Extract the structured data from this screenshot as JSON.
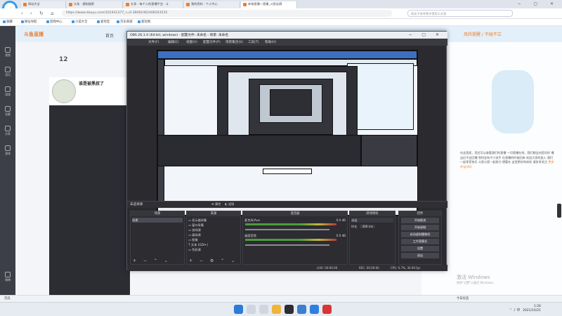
{
  "browser": {
    "tabs": [
      "网站大全",
      "头条 · 搜狗搜索",
      "头条 - 每个人的直播平台 · 斗",
      "我的资料 - 个人中心",
      "体育直播一直播_斗鱼无碍"
    ],
    "url": "https://www.douyu.com/101441377_r=0.36092462408203535",
    "search_placeholder": "周女子高考数学惯用公式表",
    "bookmarks": [
      "收藏",
      "网址导航",
      "游戏中心",
      "小说大全",
      "爱淘宝",
      "京东商城",
      "爱玩网"
    ]
  },
  "sidebar": {
    "items": [
      "视频",
      "资讯",
      "游戏",
      "话题",
      "分享",
      "游戏",
      "微博"
    ]
  },
  "douyu": {
    "logo": "斗鱼直播",
    "nav": "首页",
    "count": "12",
    "anchor_name": "谁是被黑叔了",
    "right_banner": "风险提醒 / 不碰不立",
    "panel_text": "在这里面，您还可以查看我们的直播 一切直播在线，我们都会向您问好 播出后不会回播 到时会有不少选手 在直播的时候回来 欢迎大家的加入 我们一起享受快乐 斗鱼与您一起努力 想要在 这里更好的体验 请多多关注",
    "link_text": "更多评论(40)",
    "win_activate": "激活 Windows",
    "win_activate_sub": "转到“设置”以激活 Windows。"
  },
  "obs": {
    "title": "OBS 26.1.0 (64-bit, windows) - 配置文件: 未命名 - 场景: 未命名",
    "menu": [
      "文件(F)",
      "编辑(E)",
      "视图(V)",
      "配置文件(P)",
      "场景集合(S)",
      "工具(T)",
      "帮助(H)"
    ],
    "scene_label": "未选择源",
    "scene_props": "属性",
    "scene_filter": "滤镜",
    "panels": {
      "scenes": "场景",
      "sources": "来源",
      "mixer": "混音器",
      "transitions": "转场特效",
      "controls": "控件"
    },
    "scenes": [
      "场景"
    ],
    "sources": [
      "显示器采集",
      "窗口采集",
      "游戏源",
      "媒体源",
      "图像",
      "文本 (GDI+)",
      "色彩源"
    ],
    "mixer": [
      {
        "name": "麦克风/Aux",
        "db": "0.0 dB"
      },
      {
        "name": "桌面音频",
        "db": "0.0 dB"
      }
    ],
    "transition": {
      "type": "淡出",
      "duration_label": "时长",
      "duration": "300 ms"
    },
    "controls": [
      "开始推流",
      "开始录制",
      "启动虚拟摄像机",
      "工作室模式",
      "设置",
      "退出"
    ],
    "status": {
      "live": "LIVE: 00:00:00",
      "rec": "REC: 00:00:00",
      "cpu": "CPU: 0.7%, 30.00 fps"
    }
  },
  "statusbar": {
    "left": "完成",
    "right": "今日优选"
  },
  "clock": {
    "time": "1:26",
    "date": "2021/10/21"
  }
}
